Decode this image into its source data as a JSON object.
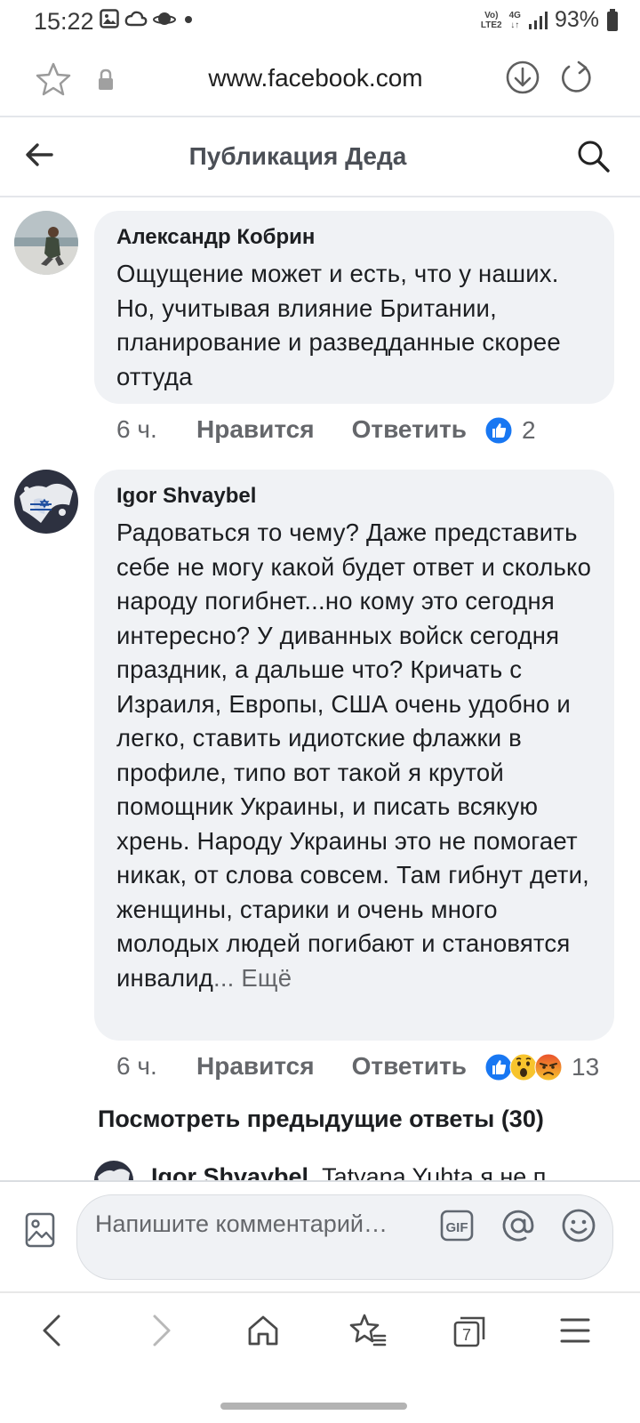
{
  "status_bar": {
    "time": "15:22",
    "network_top": "Vo)",
    "network_bottom": "LTE2",
    "signal_type": "4G",
    "battery": "93%"
  },
  "browser": {
    "url": "www.facebook.com"
  },
  "header": {
    "title": "Публикация Деда"
  },
  "comments": [
    {
      "author": "Александр Кобрин",
      "text": "Ощущение может и есть, что у наших. Но, учитывая влияние Британии, планирование и разведданные скорее оттуда",
      "time": "6 ч.",
      "like_label": "Нравится",
      "reply_label": "Ответить",
      "reaction_count": "2",
      "reactions": [
        "like"
      ]
    },
    {
      "author": "Igor Shvaybel",
      "text": "Радоваться то чему? Даже представить себе не могу какой будет ответ и сколько народу погибнет...но кому это сегодня интересно? У диванных войск сегодня праздник, а дальше что? Кричать с Израиля, Европы,  США очень удобно и легко, ставить идиотские флажки в профиле, типо вот такой я крутой помощник Украины, и писать всякую хрень. Народу Украины это не помогает никак, от слова совсем. Там гибнут дети, женщины, старики и очень много молодых людей погибают и становятся инвалид",
      "more_label": "... Ещё",
      "time": "6 ч.",
      "like_label": "Нравится",
      "reply_label": "Ответить",
      "reaction_count": "13",
      "reactions": [
        "like",
        "wow",
        "angry"
      ]
    }
  ],
  "view_previous": "Посмотреть предыдущие ответы (30)",
  "next_reply_peek": {
    "author": "Igor Shvaybel",
    "text": "Tatyana Yuhta я не п"
  },
  "composer": {
    "placeholder": "Напишите комментарий…",
    "gif_label": "GIF"
  },
  "bottom_nav": {
    "tabs_count": "7"
  },
  "colors": {
    "like_blue": "#1877f2",
    "bubble_bg": "#f0f2f5",
    "secondary_text": "#65676b"
  }
}
